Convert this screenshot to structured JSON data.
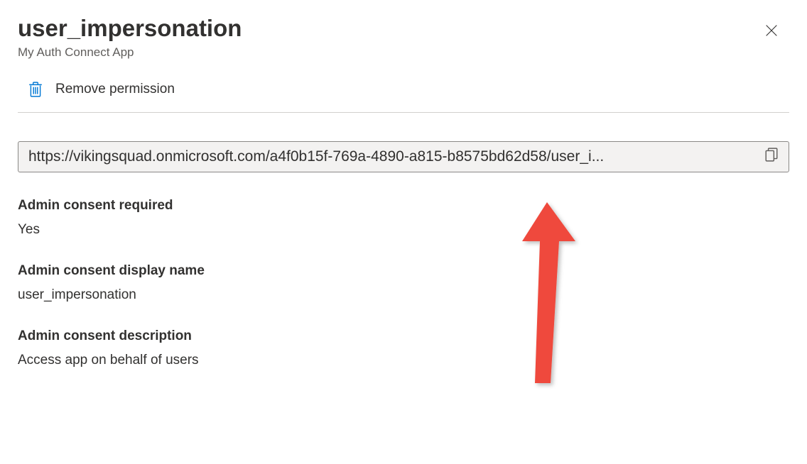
{
  "header": {
    "title": "user_impersonation",
    "subtitle": "My Auth Connect App"
  },
  "actions": {
    "remove_label": "Remove permission"
  },
  "url_value": "https://vikingsquad.onmicrosoft.com/a4f0b15f-769a-4890-a815-b8575bd62d58/user_i...",
  "fields": {
    "admin_consent_required": {
      "label": "Admin consent required",
      "value": "Yes"
    },
    "admin_consent_display_name": {
      "label": "Admin consent display name",
      "value": "user_impersonation"
    },
    "admin_consent_description": {
      "label": "Admin consent description",
      "value": "Access app on behalf of users"
    }
  }
}
